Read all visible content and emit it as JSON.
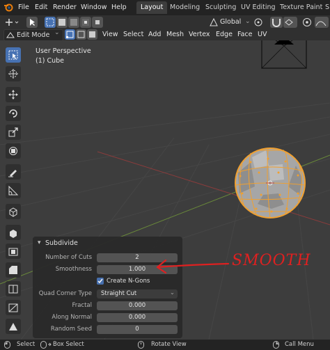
{
  "menu": [
    "File",
    "Edit",
    "Render",
    "Window",
    "Help"
  ],
  "workspaces": [
    "Layout",
    "Modeling",
    "Sculpting",
    "UV Editing",
    "Texture Paint",
    "S"
  ],
  "header": {
    "mode": "Edit Mode",
    "menus": [
      "View",
      "Select",
      "Add",
      "Mesh",
      "Vertex",
      "Edge",
      "Face",
      "UV"
    ],
    "orientation": "Global"
  },
  "viewport": {
    "perspective": "User Perspective",
    "object": "(1) Cube"
  },
  "panel": {
    "title": "Subdivide",
    "number_of_cuts_label": "Number of Cuts",
    "number_of_cuts": "2",
    "smoothness_label": "Smoothness",
    "smoothness": "1.000",
    "create_ngons_label": "Create N-Gons",
    "create_ngons": true,
    "quad_corner_label": "Quad Corner Type",
    "quad_corner": "Straight Cut",
    "fractal_label": "Fractal",
    "fractal": "0.000",
    "along_normal_label": "Along Normal",
    "along_normal": "0.000",
    "random_seed_label": "Random Seed",
    "random_seed": "0"
  },
  "annotation": {
    "text": "SMOOTH",
    "color": "#e02020"
  },
  "status": {
    "select": "Select",
    "box_select": "Box Select",
    "rotate_view": "Rotate View",
    "call_menu": "Call Menu"
  },
  "colors": {
    "accent": "#4772b3",
    "selection": "#f0a030"
  }
}
